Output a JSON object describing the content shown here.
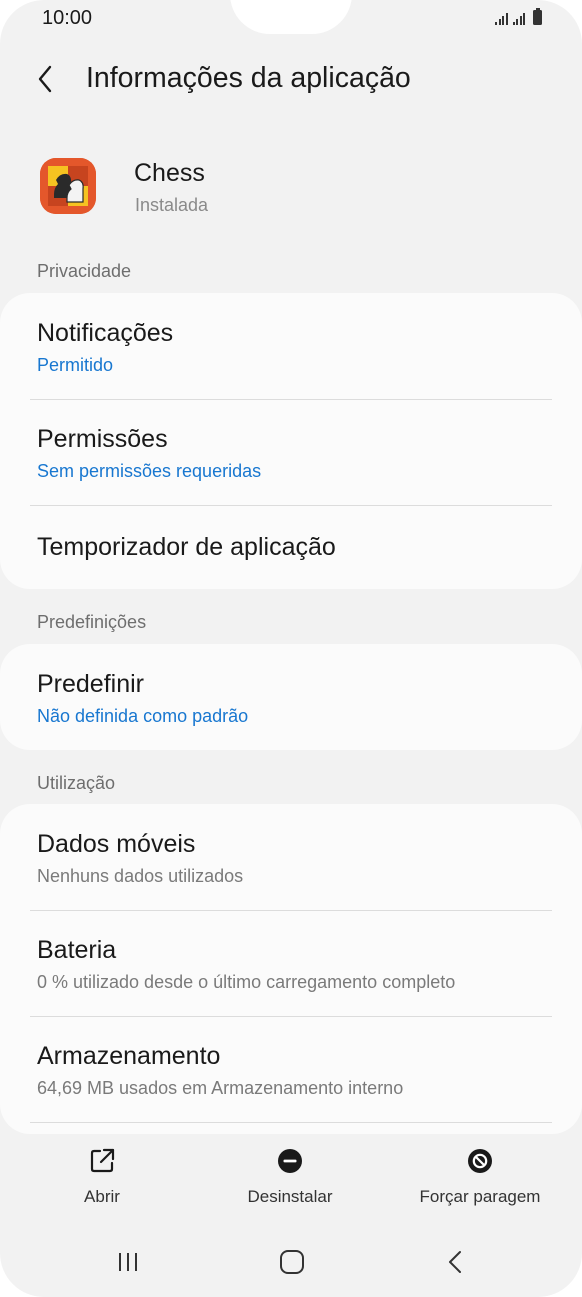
{
  "status_bar": {
    "time": "10:00",
    "icons": [
      "signal-icon",
      "signal-icon",
      "battery-icon"
    ]
  },
  "header": {
    "back_icon": "chevron-left-icon",
    "title": "Informações da aplicação"
  },
  "app": {
    "name": "Chess",
    "status": "Instalada",
    "icon": "chess-app-icon"
  },
  "sections": {
    "privacy": {
      "label": "Privacidade",
      "rows": [
        {
          "title": "Notificações",
          "subtitle": "Permitido"
        },
        {
          "title": "Permissões",
          "subtitle": "Sem permissões requeridas"
        },
        {
          "title": "Temporizador de aplicação"
        }
      ]
    },
    "defaults": {
      "label": "Predefinições",
      "rows": [
        {
          "title": "Predefinir",
          "subtitle": "Não definida como padrão"
        }
      ]
    },
    "usage": {
      "label": "Utilização",
      "rows": [
        {
          "title": "Dados móveis",
          "subtitle": "Nenhuns dados utilizados"
        },
        {
          "title": "Bateria",
          "subtitle": "0 % utilizado desde o último carregamento completo"
        },
        {
          "title": "Armazenamento",
          "subtitle": "64,69 MB usados em Armazenamento interno"
        }
      ]
    }
  },
  "actions": {
    "open": {
      "label": "Abrir",
      "icon": "open-external-icon"
    },
    "uninstall": {
      "label": "Desinstalar",
      "icon": "minus-circle-icon"
    },
    "force_stop": {
      "label": "Forçar paragem",
      "icon": "block-icon"
    }
  },
  "navbar": {
    "recents_icon": "recents-icon",
    "home_icon": "home-icon",
    "back_icon": "back-icon"
  },
  "colors": {
    "background": "#f2f2f2",
    "card": "#fbfbfb",
    "accent_blue": "#1877d0",
    "secondary_text": "#7a7a7a"
  }
}
